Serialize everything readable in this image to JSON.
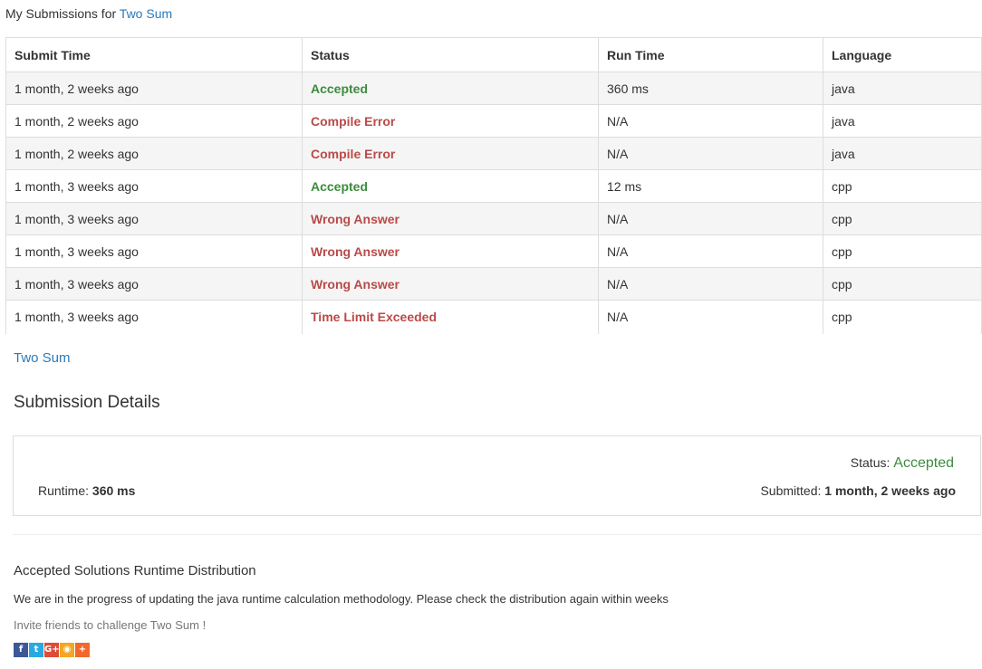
{
  "header": {
    "prefix": "My Submissions for",
    "problem_link": "Two Sum"
  },
  "table": {
    "columns": [
      "Submit Time",
      "Status",
      "Run Time",
      "Language"
    ],
    "rows": [
      {
        "time": "1 month, 2 weeks ago",
        "status": "Accepted",
        "runtime": "360 ms",
        "lang": "java"
      },
      {
        "time": "1 month, 2 weeks ago",
        "status": "Compile Error",
        "runtime": "N/A",
        "lang": "java"
      },
      {
        "time": "1 month, 2 weeks ago",
        "status": "Compile Error",
        "runtime": "N/A",
        "lang": "java"
      },
      {
        "time": "1 month, 3 weeks ago",
        "status": "Accepted",
        "runtime": "12 ms",
        "lang": "cpp"
      },
      {
        "time": "1 month, 3 weeks ago",
        "status": "Wrong Answer",
        "runtime": "N/A",
        "lang": "cpp"
      },
      {
        "time": "1 month, 3 weeks ago",
        "status": "Wrong Answer",
        "runtime": "N/A",
        "lang": "cpp"
      },
      {
        "time": "1 month, 3 weeks ago",
        "status": "Wrong Answer",
        "runtime": "N/A",
        "lang": "cpp"
      },
      {
        "time": "1 month, 3 weeks ago",
        "status": "Time Limit Exceeded",
        "runtime": "N/A",
        "lang": "cpp"
      }
    ]
  },
  "problem_link": "Two Sum",
  "details": {
    "title": "Submission Details",
    "runtime_label": "Runtime:",
    "runtime_value": "360 ms",
    "status_label": "Status:",
    "status_value": "Accepted",
    "submitted_label": "Submitted:",
    "submitted_value": "1 month, 2 weeks ago"
  },
  "distribution": {
    "title": "Accepted Solutions Runtime Distribution",
    "note": "We are in the progress of updating the java runtime calculation methodology. Please check the distribution again within weeks",
    "invite": "Invite friends to challenge Two Sum !"
  },
  "social": [
    {
      "name": "facebook-icon",
      "glyph": "f",
      "color": "#3b5998"
    },
    {
      "name": "twitter-icon",
      "glyph": "t",
      "color": "#2aa9e0"
    },
    {
      "name": "google-plus-icon",
      "glyph": "G+",
      "color": "#dd4b39"
    },
    {
      "name": "weibo-icon",
      "glyph": "◉",
      "color": "#f5a623"
    },
    {
      "name": "share-more-icon",
      "glyph": "+",
      "color": "#f2672a"
    }
  ],
  "colors": {
    "accepted": "#3d8b3d",
    "error": "#b94a48",
    "link": "#2a7ab8"
  }
}
